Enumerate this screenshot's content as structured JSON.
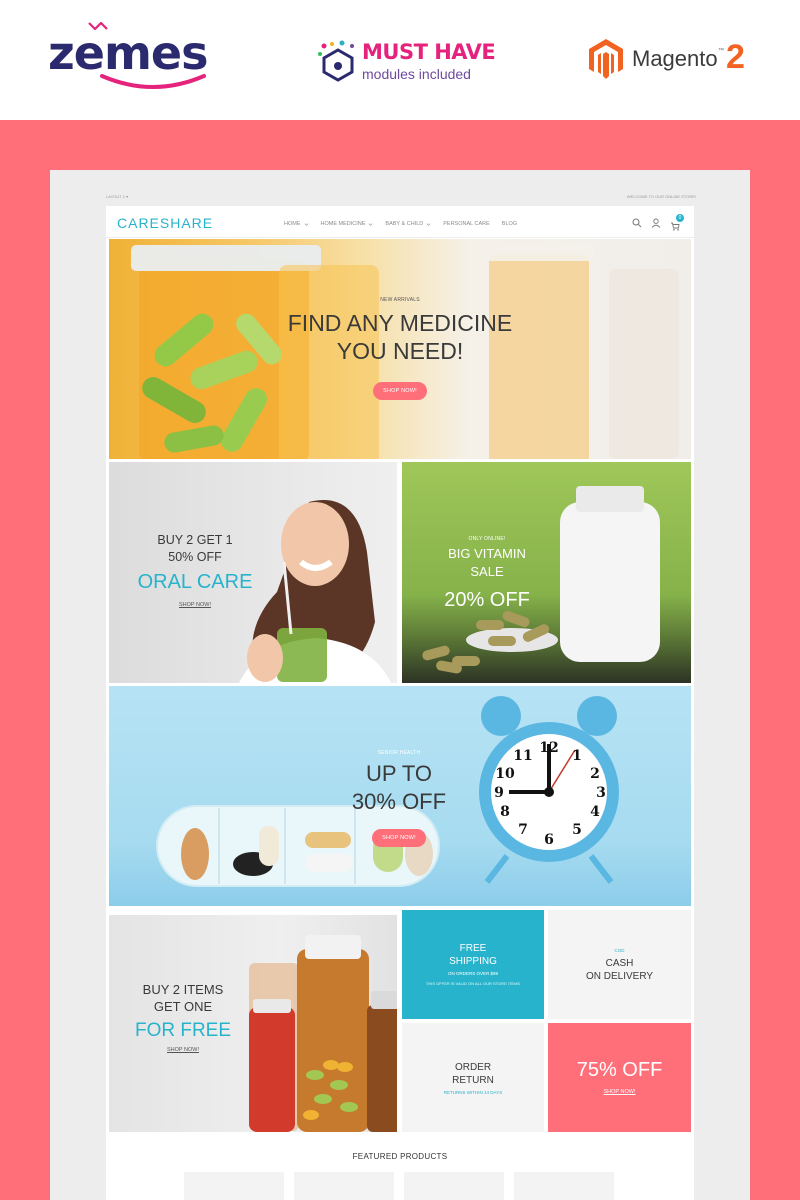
{
  "promo": {
    "brand": "zemes",
    "badge_title": "MUST HAVE",
    "badge_subtitle": "modules included",
    "platform_name": "Magento",
    "platform_tm": "™",
    "platform_version": "2",
    "colors": {
      "brand": "#2b2a6e",
      "brand_accent": "#e5237c",
      "badge_title": "#e5237c",
      "badge_subtitle": "#6f4a9e",
      "platform": "#f26322",
      "background": "#ff6f7a"
    }
  },
  "topline": {
    "left": "LAYOUT 1 ▾",
    "right": "WELCOME TO OUR ONLINE STORE!"
  },
  "header": {
    "logo": "CARESHARE",
    "nav": [
      {
        "label": "HOME",
        "dropdown": true
      },
      {
        "label": "HOME MEDICINE",
        "dropdown": true
      },
      {
        "label": "BABY & CHILD",
        "dropdown": true
      },
      {
        "label": "PERSONAL CARE",
        "dropdown": false
      },
      {
        "label": "BLOG",
        "dropdown": false
      }
    ],
    "icons": [
      "search-icon",
      "user-icon",
      "cart-icon"
    ],
    "cart_count": "0",
    "accent": "#27b3cc"
  },
  "hero": {
    "eyebrow": "NEW ARRIVALS",
    "title_line1": "FIND ANY MEDICINE",
    "title_line2": "YOU NEED!",
    "button": "SHOP NOW!"
  },
  "promo_oral": {
    "line1": "BUY 2 GET 1",
    "line2": "50% OFF",
    "highlight": "ORAL CARE",
    "link": "SHOP NOW!"
  },
  "promo_vitamin": {
    "eyebrow": "ONLY ONLINE!",
    "line1": "BIG VITAMIN",
    "line2": "SALE",
    "highlight": "20% OFF"
  },
  "promo_senior": {
    "eyebrow": "SENIOR HEALTH",
    "line1": "UP TO",
    "line2": "30% OFF",
    "button": "SHOP NOW!"
  },
  "promo_free": {
    "line1": "BUY 2 ITEMS",
    "line2": "GET ONE",
    "highlight": "FOR FREE",
    "link": "SHOP NOW!"
  },
  "info_shipping": {
    "line1": "FREE",
    "line2": "SHIPPING",
    "sub1": "ON ORDERS OVER $99",
    "sub2": "THIS OFFER IS VALID ON ALL OUR STORE ITEMS"
  },
  "info_cod": {
    "eyebrow": "COD",
    "line1": "CASH",
    "line2": "ON DELIVERY"
  },
  "info_return": {
    "line1": "ORDER",
    "line2": "RETURN",
    "sub": "RETURNS WITHIN 14 DAYS"
  },
  "info_sale": {
    "title": "75% OFF",
    "link": "SHOP NOW!"
  },
  "featured": {
    "title": "FEATURED PRODUCTS"
  },
  "colors": {
    "teal": "#27b3cc",
    "pink": "#ff6f7a",
    "text": "#3a3a3a"
  }
}
